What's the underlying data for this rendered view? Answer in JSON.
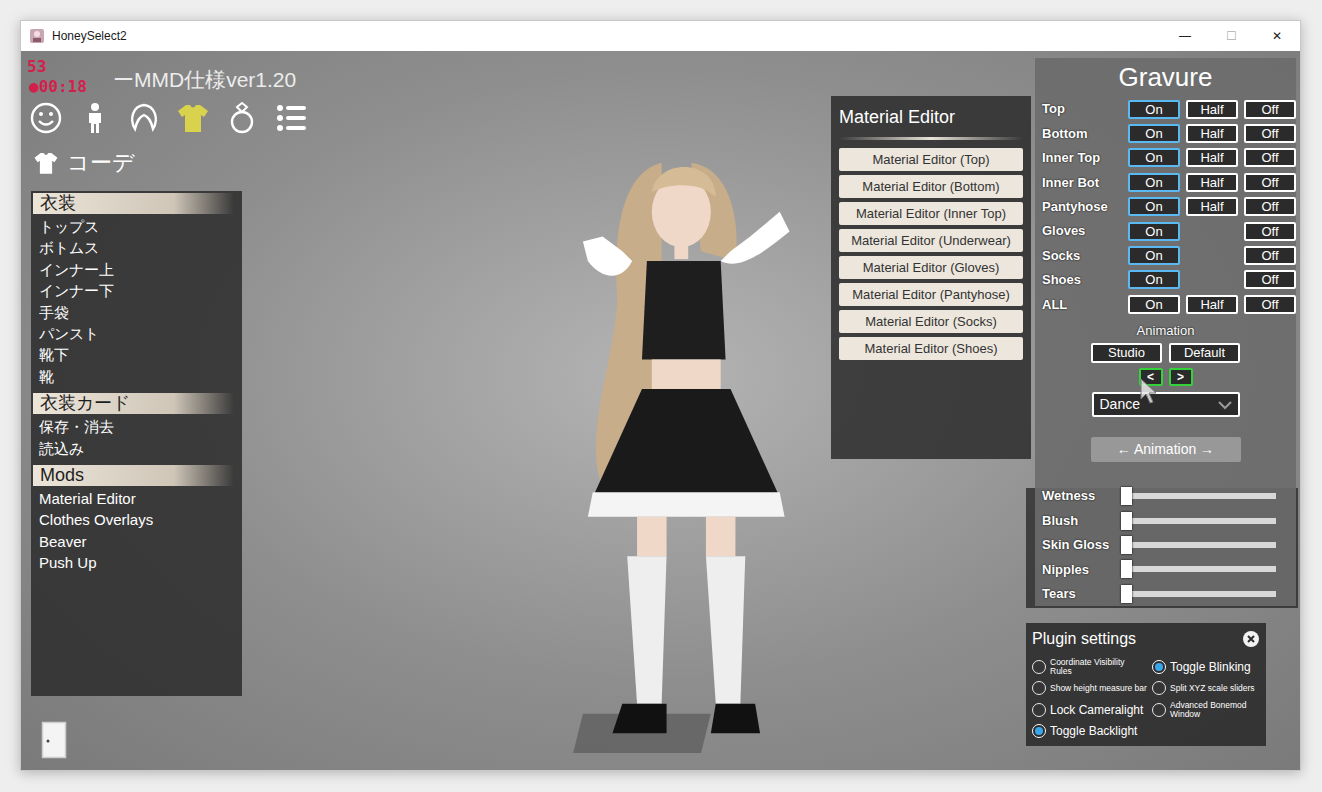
{
  "window": {
    "title": "HoneySelect2",
    "controls": [
      "—",
      "☐",
      "✕"
    ]
  },
  "hud": {
    "fps": "53",
    "recording": "●00:18",
    "title": "ーMMD仕様ver1.20"
  },
  "category_tabs": [
    {
      "selected": false
    },
    {
      "selected": false
    },
    {
      "selected": false
    },
    {
      "selected": true
    },
    {
      "selected": false
    },
    {
      "selected": false
    }
  ],
  "section_title": "コーデ",
  "sidebar": {
    "sections": [
      {
        "header": "衣装",
        "items": [
          "トップス",
          "ボトムス",
          "インナー上",
          "インナー下",
          "手袋",
          "パンスト",
          "靴下",
          "靴"
        ]
      },
      {
        "header": "衣装カード",
        "items": [
          "保存・消去",
          "読込み"
        ]
      },
      {
        "header": "Mods",
        "items": [
          "Material Editor",
          "Clothes Overlays",
          "Beaver",
          "Push Up"
        ]
      }
    ]
  },
  "material_editor": {
    "title": "Material Editor",
    "buttons": [
      "Material Editor (Top)",
      "Material Editor (Bottom)",
      "Material Editor (Inner Top)",
      "Material Editor (Underwear)",
      "Material Editor (Gloves)",
      "Material Editor (Pantyhose)",
      "Material Editor (Socks)",
      "Material Editor (Shoes)"
    ]
  },
  "gravure": {
    "title": "Gravure",
    "rows": [
      {
        "label": "Top",
        "options": [
          {
            "label": "On",
            "selected": true
          },
          {
            "label": "Half",
            "selected": false
          },
          {
            "label": "Off",
            "selected": false
          }
        ]
      },
      {
        "label": "Bottom",
        "options": [
          {
            "label": "On",
            "selected": true
          },
          {
            "label": "Half",
            "selected": false
          },
          {
            "label": "Off",
            "selected": false
          }
        ]
      },
      {
        "label": "Inner Top",
        "options": [
          {
            "label": "On",
            "selected": true
          },
          {
            "label": "Half",
            "selected": false
          },
          {
            "label": "Off",
            "selected": false
          }
        ]
      },
      {
        "label": "Inner Bot",
        "options": [
          {
            "label": "On",
            "selected": true
          },
          {
            "label": "Half",
            "selected": false
          },
          {
            "label": "Off",
            "selected": false
          }
        ]
      },
      {
        "label": "Pantyhose",
        "options": [
          {
            "label": "On",
            "selected": true
          },
          {
            "label": "Half",
            "selected": false
          },
          {
            "label": "Off",
            "selected": false
          }
        ]
      },
      {
        "label": "Gloves",
        "options": [
          {
            "label": "On",
            "selected": true
          },
          {
            "label": "Off",
            "selected": false
          }
        ]
      },
      {
        "label": "Socks",
        "options": [
          {
            "label": "On",
            "selected": true
          },
          {
            "label": "Off",
            "selected": false
          }
        ]
      },
      {
        "label": "Shoes",
        "options": [
          {
            "label": "On",
            "selected": true
          },
          {
            "label": "Off",
            "selected": false
          }
        ]
      },
      {
        "label": "ALL",
        "options": [
          {
            "label": "On",
            "selected": false
          },
          {
            "label": "Half",
            "selected": false
          },
          {
            "label": "Off",
            "selected": false
          }
        ]
      }
    ],
    "animation_label": "Animation",
    "mode_buttons": [
      "Studio",
      "Default"
    ],
    "step_buttons": [
      "<",
      ">"
    ],
    "dropdown": {
      "value": "Dance"
    },
    "animation_button": "← Animation →",
    "sliders": [
      {
        "label": "Wetness",
        "level": 0
      },
      {
        "label": "Blush",
        "level": 0
      },
      {
        "label": "Skin Gloss",
        "level": 0
      },
      {
        "label": "Nipples",
        "level": 0
      },
      {
        "label": "Tears",
        "level": 0
      }
    ]
  },
  "plugin_settings": {
    "title": "Plugin settings",
    "left": [
      {
        "label": "Coordinate Visibility Rules",
        "kind": "small",
        "selected": false
      },
      {
        "label": "Show height measure bar",
        "kind": "small",
        "selected": false
      },
      {
        "label": "Lock Cameralight",
        "kind": "normal",
        "selected": false
      },
      {
        "label": "Toggle Backlight",
        "kind": "normal",
        "selected": true
      }
    ],
    "right": [
      {
        "label": "Toggle Blinking",
        "kind": "normal",
        "selected": true
      },
      {
        "label": "Split XYZ scale sliders",
        "kind": "small",
        "selected": false
      },
      {
        "label": "Advanced Bonemod Window",
        "kind": "small",
        "selected": false
      }
    ]
  }
}
